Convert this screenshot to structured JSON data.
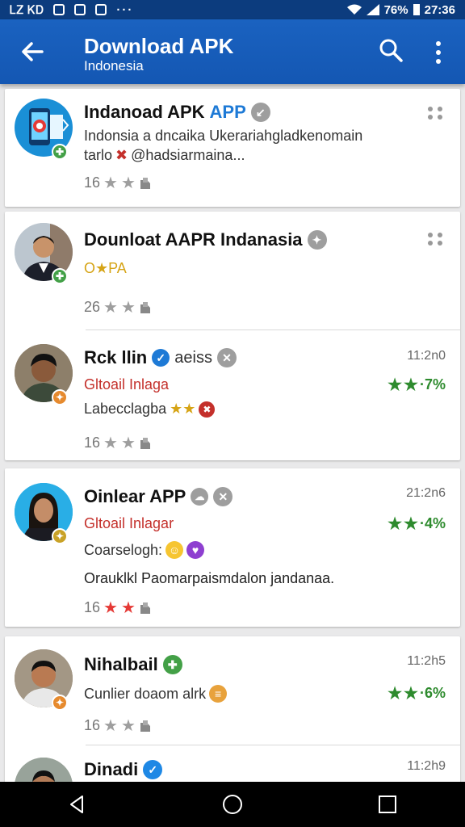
{
  "status_bar": {
    "left_text": "ᏞᏃ ᏦᎠ",
    "dots": "···",
    "battery": "76%",
    "time": "27:36"
  },
  "app_bar": {
    "title": "Download APK",
    "subtitle": "Indonesia"
  },
  "items": [
    {
      "name": "Indanoad APK",
      "name_accent": "APP",
      "line1": "Indonsia a dncaika Ukerariahgladkenomain",
      "line2_prefix": "tarlo",
      "line2_rest": "@hadsiarmaina...",
      "count": "16",
      "icon": "app-icon"
    },
    {
      "name": "Dounloat AAPR Indanasia",
      "line1": "O★PA",
      "count": "26",
      "icon": "person-avatar"
    },
    {
      "name": "Rck llin",
      "name_tag": "aeiss",
      "time": "11:2n0",
      "line1": "Gltoail Inlaga",
      "rating": "·7%",
      "line2": "Labecclagba",
      "count": "16",
      "icon": "person-avatar"
    },
    {
      "name": "Oinlear APP",
      "time": "21:2n6",
      "line1": "Gltoail Inlagar",
      "rating": "·4%",
      "line2": "Coarselogh:",
      "line3": "Orauklkl Paomarpaismdalon jandanaa.",
      "count": "16",
      "icon": "person-avatar"
    },
    {
      "name": "Nihalbail",
      "time": "11:2h5",
      "line1": "Cunlier doaom alrk",
      "rating": "·6%",
      "count": "16",
      "icon": "person-avatar"
    },
    {
      "name": "Dinadi",
      "time": "11:2h9",
      "icon": "person-avatar"
    }
  ],
  "colors": {
    "app_bar": "#1565c0",
    "status_bar": "#0c3c7e",
    "rating_green": "#2e8b2e",
    "accent_red": "#c4302b"
  }
}
